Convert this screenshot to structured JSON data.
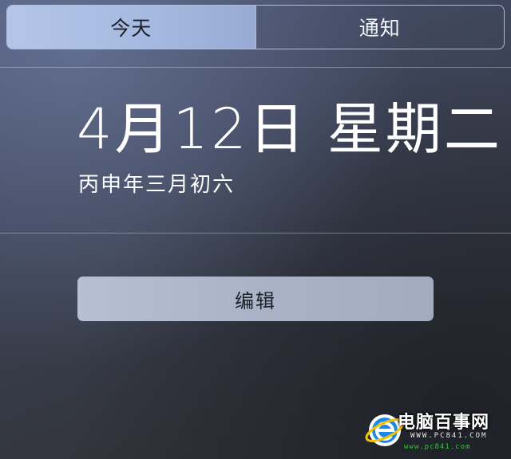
{
  "tabs": [
    {
      "label": "今天",
      "active": true
    },
    {
      "label": "通知",
      "active": false
    }
  ],
  "today": {
    "date_title": "4月12日 星期二",
    "lunar_date": "丙申年三月初六"
  },
  "edit_button": {
    "label": "编辑"
  },
  "watermark": {
    "main": "电脑百事网",
    "sub": "WWW.PC841.COM",
    "url": "www.pc841.com"
  },
  "colors": {
    "active_tab": "#aabde3",
    "button": "#aeb6ca",
    "watermark_url": "#35c23a",
    "logo_blue": "#1e88e5"
  },
  "icons": {
    "watermark_logo": "ie-style-e-logo"
  }
}
